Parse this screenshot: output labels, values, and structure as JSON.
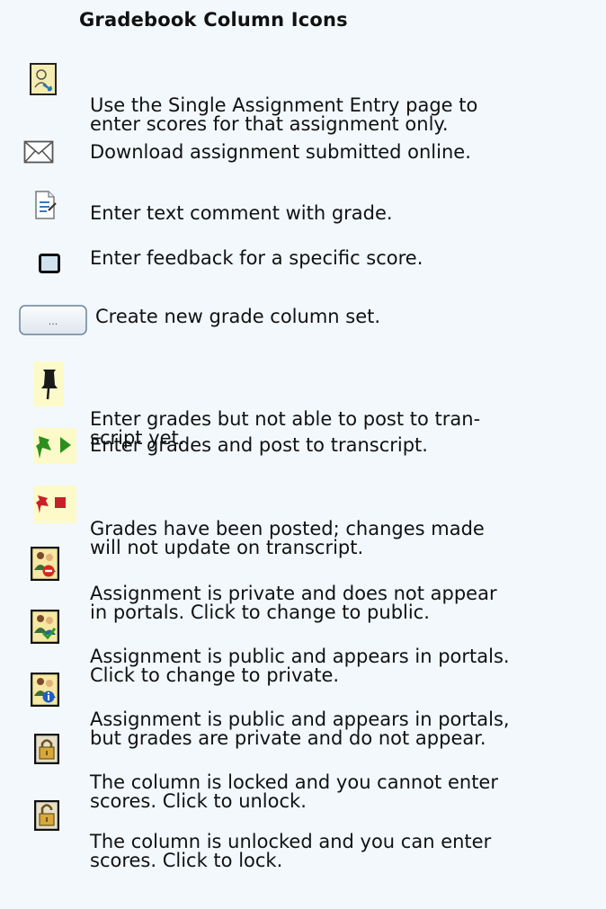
{
  "title": "Gradebook Column Icons",
  "items": [
    {
      "icon": "single-assignment-entry-icon",
      "lines": [
        "Use the Single Assignment Entry page to",
        "enter scores for that assignment only."
      ]
    },
    {
      "icon": "envelope-icon",
      "lines": [
        "Download assignment submitted online."
      ]
    },
    {
      "icon": "text-comment-icon",
      "lines": [
        "Enter text comment with grade."
      ]
    },
    {
      "icon": "feedback-box-icon",
      "lines": [
        "Enter feedback for a specific score."
      ]
    },
    {
      "icon": "ellipsis-button-icon",
      "button_label": "...",
      "lines": [
        "Create new grade column set."
      ]
    },
    {
      "icon": "black-pushpin-icon",
      "lines": [
        "Enter grades but not able to post to tran-",
        "script yet."
      ]
    },
    {
      "icon": "green-pushpin-play-icon",
      "lines": [
        "Enter grades and post to transcript."
      ]
    },
    {
      "icon": "red-pushpin-stop-icon",
      "lines": [
        "Grades have been posted; changes made",
        "will not update on transcript."
      ]
    },
    {
      "icon": "people-private-icon",
      "lines": [
        "Assignment is private and does not appear",
        "in portals. Click to change to public."
      ]
    },
    {
      "icon": "people-public-icon",
      "lines": [
        "Assignment is public and appears in portals.",
        "Click to change to private."
      ]
    },
    {
      "icon": "people-grades-private-icon",
      "lines": [
        "Assignment is public and appears in portals,",
        "but grades are private and do not appear."
      ]
    },
    {
      "icon": "padlock-locked-icon",
      "lines": [
        "The column is locked and you cannot enter",
        "scores. Click to unlock."
      ]
    },
    {
      "icon": "padlock-unlocked-icon",
      "lines": [
        "The column is unlocked and you can enter",
        "scores. Click to lock."
      ]
    }
  ]
}
